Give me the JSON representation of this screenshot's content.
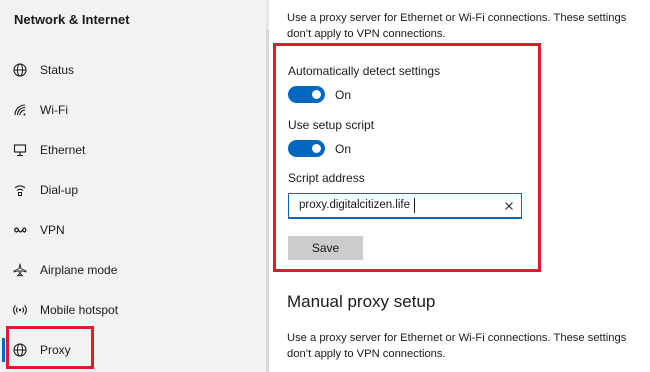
{
  "sidebar": {
    "title": "Network & Internet",
    "items": [
      {
        "label": "Status",
        "icon": "globe-status-icon"
      },
      {
        "label": "Wi-Fi",
        "icon": "wifi-icon"
      },
      {
        "label": "Ethernet",
        "icon": "ethernet-icon"
      },
      {
        "label": "Dial-up",
        "icon": "dialup-icon"
      },
      {
        "label": "VPN",
        "icon": "vpn-icon"
      },
      {
        "label": "Airplane mode",
        "icon": "airplane-icon"
      },
      {
        "label": "Mobile hotspot",
        "icon": "hotspot-icon"
      },
      {
        "label": "Proxy",
        "icon": "globe-icon"
      }
    ],
    "active_index": 7
  },
  "auto_section": {
    "description": "Use a proxy server for Ethernet or Wi-Fi connections. These settings don’t apply to VPN connections.",
    "auto_detect_label": "Automatically detect settings",
    "auto_detect_state": "On",
    "setup_script_label": "Use setup script",
    "setup_script_state": "On",
    "script_address_label": "Script address",
    "script_address_value": "proxy.digitalcitizen.life",
    "save_label": "Save"
  },
  "manual_section": {
    "title": "Manual proxy setup",
    "description": "Use a proxy server for Ethernet or Wi-Fi connections. These settings don’t apply to VPN connections."
  },
  "colors": {
    "accent": "#0067c0",
    "highlight": "#e0192e",
    "sidebar_bg": "#f2f2f2"
  }
}
